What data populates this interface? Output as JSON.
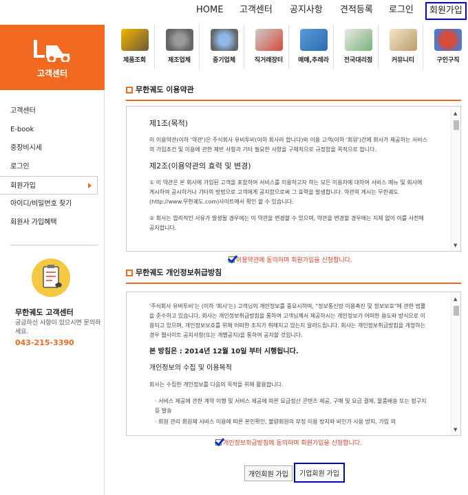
{
  "topnav": [
    "HOME",
    "고객센터",
    "공지사항",
    "견적등록",
    "로그인",
    "회원가입"
  ],
  "sidebar": {
    "title": "고객센터",
    "menu": [
      "고객센터",
      "E-book",
      "중장비시세",
      "로그인",
      "회원가입",
      "아이디/비밀번호 찾기",
      "회원사 가입혜택"
    ],
    "center_name": "무한궤도 고객센터",
    "center_desc": "궁금하신 사항이 있으시면 문의하세요.",
    "center_phone": "043-215-3390"
  },
  "icons": [
    "제품조회",
    "제조업체",
    "중기업체",
    "직거래장터",
    "매매,추레라",
    "전국대리점",
    "커뮤니티",
    "구인구직"
  ],
  "terms": {
    "heading": "무한궤도 이용약관",
    "art1_title": "제1조(목적)",
    "art1_body": "이 이용약관(이하 '약관')은 주식회사 유비투비(이하 회사라 합니다)와 이용 고객(이하 '회원')간에 회사가 제공하는 서비스의 가입조건 및 이용에 관한 제반 사항과 기타 필요한 사항을 구체적으로 규정함을 목적으로 합니다.",
    "art2_title": "제2조(이용약관의 효력 및 변경)",
    "art2_p1": "① 이 약관은 본 회사에 가입된 고객을 포함하여 서비스를 이용하고자 하는 모든 이용자에 대하여 서비스 메뉴 및 회사에 게시하여 공시하거나 기타의 방법으로 고객에게 공지함으로써 그 효력을 발생합니다. 약관의 게시는 무한궤도(http://www.무한궤도.com)사이트에서 확인 할 수 있습니다.",
    "art2_p2": "② 회사는 합리적인 사유가 발생될 경우에는 이 약관을 변경할 수 있으며, 약관을 변경할 경우에는 지체 없이 이를 사전에 공지합니다.",
    "agree": "이용약관에 동의하며 회원가입을 신청합니다."
  },
  "privacy": {
    "heading": "무한궤도 개인정보취급방침",
    "intro": "'주식회사 유비투비'는 (이하 '회사'는) 고객님의 개인정보를 중요시하며, \"정보통신망 이용촉진 및 정보보호\"에 관한 법률을 준수하고 있습니다. 회사는 개인정보취급방침을 통하여 고객님께서 제공하시는 개인정보가 어떠한 용도와 방식으로 이용되고 있으며, 개인정보보호를 위해 어떠한 조치가 취해지고 있는지 알려드립니다. 회사는 개인정보취급방침을 개정하는 경우 웹사이트 공지사항(또는 개별공지)을 통하여 공지할 것입니다.",
    "effective": "본 방침은 : 2014년 12월 10일 부터 시행됩니다.",
    "collect_title": "개인정보의 수집 및 이용목적",
    "collect_intro": "회사는 수집한 개인정보를 다음의 목적을 위해 활용합니다.",
    "item1": "· 서비스 제공에 관한 계약 이행 및 서비스 제공에 따른 요금정산 콘텐츠 제공, 구매 및 요금 결제, 물품배송 또는 청구지등 발송",
    "item2": "· 회원 관리 회원제 서비스 이용에 따른 본인확인, 불량회원의 부정 이용 방지와 비인가 사용 방지, 가입 의",
    "agree": "개인정보취급방침에 동의하며 회원가입을 신청합니다."
  },
  "buttons": {
    "personal": "개인회원 가입",
    "corporate": "기업회원 가입"
  }
}
